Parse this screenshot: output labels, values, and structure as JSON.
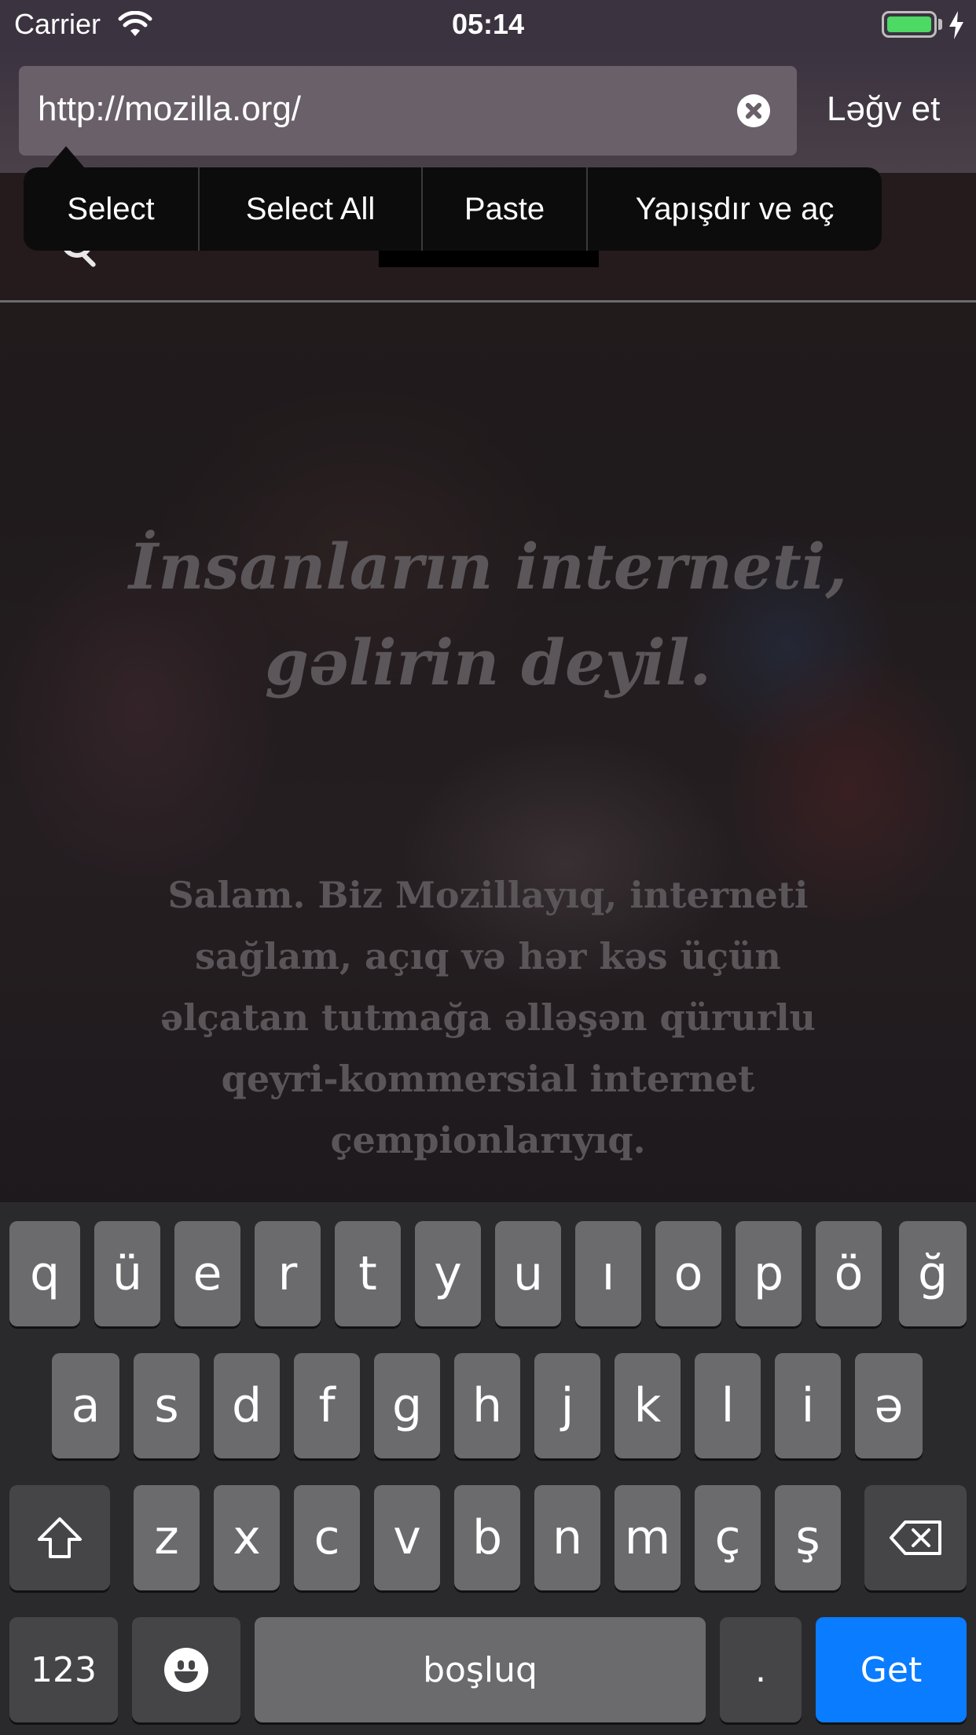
{
  "status_bar": {
    "carrier": "Carrier",
    "time": "05:14",
    "battery_color": "#4cd964"
  },
  "url_bar": {
    "url": "http://mozilla.org/",
    "clear_icon": "clear-circle-icon",
    "cancel_label": "Ləğv et"
  },
  "edit_menu": {
    "items": [
      "Select",
      "Select All",
      "Paste",
      "Yapışdır ve aç"
    ]
  },
  "page": {
    "hero_title": "İnsanların interneti, gəlirin deyil.",
    "hero_text": "Salam. Biz Mozillayıq, interneti sağlam, açıq və hər kəs üçün əlçatan tutmağa əlləşən qürurlu qeyri-kommersial internet çempionlarıyıq."
  },
  "keyboard": {
    "row1": [
      "q",
      "ü",
      "e",
      "r",
      "t",
      "y",
      "u",
      "ı",
      "o",
      "p",
      "ö",
      "ğ"
    ],
    "row2": [
      "a",
      "s",
      "d",
      "f",
      "g",
      "h",
      "j",
      "k",
      "l",
      "i",
      "ə"
    ],
    "row3": [
      "z",
      "x",
      "c",
      "v",
      "b",
      "n",
      "m",
      "ç",
      "ş"
    ],
    "numbers_label": "123",
    "space_label": "boşluq",
    "period_label": ".",
    "go_label": "Get",
    "go_color": "#0a7cff"
  }
}
